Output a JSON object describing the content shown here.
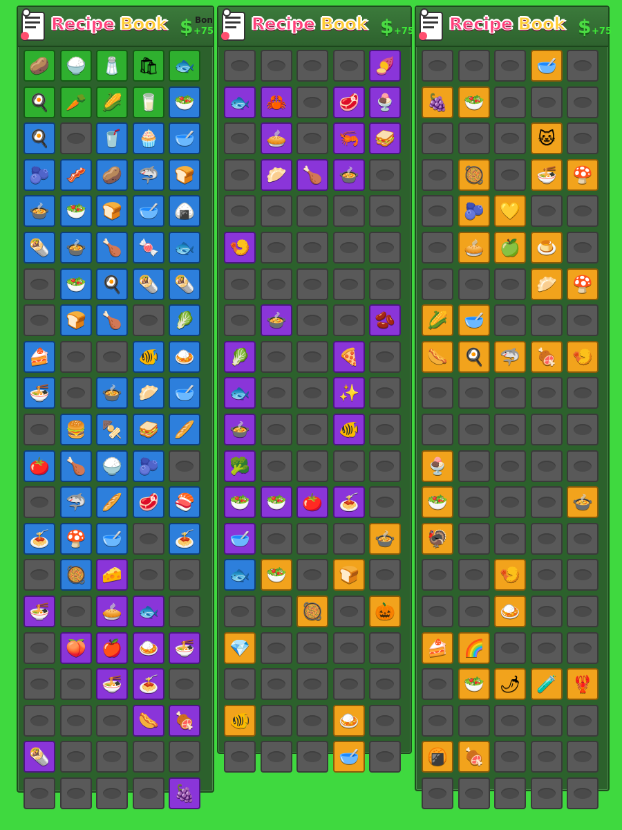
{
  "panels": [
    {
      "title_part1": "Recipe ",
      "title_part2": "Book",
      "bonus_label": "Bon",
      "bonus_value": "+75",
      "rows": [
        [
          "green:potato-icon:🥔",
          "green:rice-bowl-icon:🍚",
          "green:salt-shaker-icon:🧂",
          "green:toasted-flour-bag-icon:🛍",
          "green:fish-icon:🐟"
        ],
        [
          "green:fried-egg-icon:🍳",
          "green:carrots-icon:🥕",
          "green:corn-icon:🌽",
          "green:milk-glass-icon:🥛",
          "blue:salad-icon:🥗"
        ],
        [
          "blue:omelette-icon:🍳",
          "locked",
          "blue:smoothie-icon:🥤",
          "blue:muffin-icon:🧁",
          "blue:oatmeal-icon:🥣"
        ],
        [
          "blue:berry-bowl-icon:🫐",
          "blue:bacon-eggs-icon:🥓",
          "blue:baked-potato-icon:🥔",
          "blue:shark-fin-icon:🦈",
          "blue:bread-loaf-icon:🍞"
        ],
        [
          "blue:soup-icon:🍲",
          "blue:vegetable-salad-icon:🥗",
          "blue:toast-icon:🍞",
          "blue:cream-soup-icon:🥣",
          "blue:onigiri-icon:🍙"
        ],
        [
          "blue:burrito-icon:🌯",
          "blue:rice-soup-icon:🍲",
          "blue:drumstick-icon:🍗",
          "blue:candy-icon:🍬",
          "blue:grilled-fish-icon:🐟"
        ],
        [
          "locked",
          "blue:veggie-rice-icon:🥗",
          "blue:egg-toast-icon:🍳",
          "blue:wrap-icon:🌯",
          "blue:burrito-plate-icon:🌯"
        ],
        [
          "locked",
          "blue:bread-icon:🍞",
          "blue:chicken-legs-icon:🍗",
          "locked",
          "blue:herb-dish-icon:🥬"
        ],
        [
          "blue:cake-slice-icon:🍰",
          "locked",
          "locked",
          "blue:fish-salad-icon:🐠",
          "blue:fried-rice-icon:🍛"
        ],
        [
          "blue:ramen-icon:🍜",
          "locked",
          "blue:stew-icon:🍲",
          "blue:dumplings-icon:🥟",
          "blue:porridge-icon:🥣"
        ],
        [
          "locked",
          "blue:burger-icon:🍔",
          "blue:kebab-icon:🍢",
          "blue:sandwich-icon:🥪",
          "blue:bread-roll-icon:🥖"
        ],
        [
          "blue:tomato-icon:🍅",
          "blue:roast-chicken-icon:🍗",
          "blue:steamed-rice-icon:🍚",
          "blue:blueberry-bowl-icon:🫐",
          "locked"
        ],
        [
          "locked",
          "blue:shark-fin-soup-icon:🦈",
          "blue:breadsticks-icon:🥖",
          "blue:steak-icon:🥩",
          "blue:salmon-fillet-icon:🍣"
        ],
        [
          "blue:spaghetti-icon:🍝",
          "blue:shroom-flour-mix-icon:🍄",
          "blue:mushroom-soup-icon:🥣",
          "locked",
          "blue:pasta-bowl-icon:🍝"
        ],
        [
          "locked",
          "blue:stir-fry-icon:🥘",
          "purple:fruit-cheese-icon:🧀",
          "locked",
          "locked"
        ],
        [
          "purple:blue-noodles-icon:🍜",
          "locked",
          "purple:pie-icon:🥧",
          "purple:taiyaki-icon:🐟",
          "locked"
        ],
        [
          "locked",
          "purple:peach-icon:🍑",
          "purple:candy-apple-icon:🍎",
          "purple:curry-bowl-icon:🍛",
          "purple:noodle-bowl-icon:🍜"
        ],
        [
          "locked",
          "locked",
          "purple:noodle-soup-icon:🍜",
          "purple:pasta-plate-icon:🍝",
          "locked"
        ],
        [
          "locked",
          "locked",
          "locked",
          "purple:sausage-platter-icon:🌭",
          "purple:bbq-platter-icon:🍖"
        ],
        [
          "purple:wrap-roll-icon:🌯",
          "locked",
          "locked",
          "locked",
          "locked"
        ],
        [
          "locked",
          "locked",
          "locked",
          "locked",
          "purple:purple-dish-icon:🍇"
        ]
      ]
    },
    {
      "title_part1": "Recipe ",
      "title_part2": "Book",
      "bonus_label": "",
      "bonus_value": "+75",
      "rows": [
        [
          "locked",
          "locked",
          "locked",
          "locked",
          "purple:ube-bowl-icon:🍠"
        ],
        [
          "purple:fish-plate-icon:🐟",
          "purple:crab-bowl-icon:🦀",
          "locked",
          "purple:steak-plate-icon:🥩",
          "purple:parfait-icon:🍨"
        ],
        [
          "locked",
          "purple:berry-tart-icon:🥧",
          "locked",
          "purple:seafood-bowl-icon:🦐",
          "purple:bruschetta-icon:🥪"
        ],
        [
          "locked",
          "purple:blue-dumplings-icon:🥟",
          "purple:roast-fowl-icon:🍗",
          "purple:pot-stew-icon:🍲",
          "locked"
        ],
        [
          "locked",
          "locked",
          "locked",
          "locked",
          "locked"
        ],
        [
          "purple:fried-snacks-icon:🍤",
          "locked",
          "locked",
          "locked",
          "locked"
        ],
        [
          "locked",
          "locked",
          "locked",
          "locked",
          "locked"
        ],
        [
          "locked",
          "purple:hotpot-icon:🍲",
          "locked",
          "locked",
          "purple:bean-bowl-icon:🫘"
        ],
        [
          "purple:asparagus-icon:🥬",
          "locked",
          "locked",
          "purple:pizza-plate-icon:🍕",
          "locked"
        ],
        [
          "purple:fish-stew-icon:🐟",
          "locked",
          "locked",
          "purple:magic-soup-icon:✨",
          "locked"
        ],
        [
          "purple:lentil-pot-icon:🍲",
          "locked",
          "locked",
          "purple:grilled-fish-plate-icon:🐠",
          "locked"
        ],
        [
          "purple:broccoli-bowl-icon:🥦",
          "locked",
          "locked",
          "locked",
          "locked"
        ],
        [
          "purple:mixed-salad-icon:🥗",
          "purple:veggie-bowl-icon:🥗",
          "purple:tomato-soup-icon:🍅",
          "purple:noodle-dish-icon:🍝",
          "locked"
        ],
        [
          "purple:yogurt-bowl-icon:🥣",
          "locked",
          "locked",
          "locked",
          "orange:beef-stew-icon:🍲"
        ],
        [
          "blue:salmon-steak-icon:🐟",
          "orange:salad-bowl-icon:🥗",
          "locked",
          "orange:caviar-toast-icon:🍞",
          "locked"
        ],
        [
          "locked",
          "locked",
          "orange:chowder-icon:🥘",
          "locked",
          "orange:pumpkin-soup-icon:🎃"
        ],
        [
          "orange:crystal-bowl-icon:💎",
          "locked",
          "locked",
          "locked",
          "locked"
        ],
        [
          "locked",
          "locked",
          "locked",
          "locked",
          "locked"
        ],
        [
          "orange:fish-feast-icon:🐠",
          "locked",
          "locked",
          "orange:curry-stew-icon:🍛",
          "locked"
        ],
        [
          "locked",
          "locked",
          "locked",
          "orange:soup-bowl-icon:🥣",
          "locked"
        ]
      ]
    },
    {
      "title_part1": "Recipe ",
      "title_part2": "Book",
      "bonus_label": "",
      "bonus_value": "+75",
      "rows": [
        [
          "locked",
          "locked",
          "locked",
          "orange:dumpling-soup-icon:🥣",
          "locked"
        ],
        [
          "orange:fruit-bowl-icon:🍇",
          "orange:garden-salad-icon:🥗",
          "locked",
          "locked",
          "locked"
        ],
        [
          "locked",
          "locked",
          "locked",
          "orange:cat-parfait-icon:🐱",
          "locked"
        ],
        [
          "locked",
          "orange:veggie-stew-icon:🥘",
          "locked",
          "orange:noodle-platter-icon:🍜",
          "orange:mushroom-stew-icon:🍄"
        ],
        [
          "locked",
          "orange:berry-bowl-icon:🫐",
          "orange:heart-dessert-icon:💛",
          "locked",
          "locked"
        ],
        [
          "locked",
          "orange:fruit-tart-icon:🥧",
          "orange:golden-apple-icon:🍏",
          "orange:pudding-icon:🍮",
          "locked"
        ],
        [
          "locked",
          "locked",
          "locked",
          "orange:dim-sum-icon:🥟",
          "orange:mushroom-pie-icon:🍄"
        ],
        [
          "orange:harvest-platter-icon:🌽",
          "orange:corn-soup-icon:🥣",
          "locked",
          "locked",
          "locked"
        ],
        [
          "orange:sausage-grill-icon:🌭",
          "orange:omelette-plate-icon:🍳",
          "orange:shark-soup-icon:🦈",
          "orange:roast-plate-icon:🍖",
          "orange:seafood-pasta-icon:🍤"
        ],
        [
          "locked",
          "locked",
          "locked",
          "locked",
          "locked"
        ],
        [
          "locked",
          "locked",
          "locked",
          "locked",
          "locked"
        ],
        [
          "orange:ice-cream-sundae-icon:🍨",
          "locked",
          "locked",
          "locked",
          "locked"
        ],
        [
          "orange:herb-salad-icon:🥗",
          "locked",
          "locked",
          "locked",
          "orange:goulash-icon:🍲"
        ],
        [
          "orange:roast-turkey-icon:🦃",
          "locked",
          "locked",
          "locked",
          "locked"
        ],
        [
          "locked",
          "locked",
          "orange:shrimp-plate-icon:🍤",
          "locked",
          "locked"
        ],
        [
          "locked",
          "locked",
          "orange:rice-plate-icon:🍛",
          "locked",
          "locked"
        ],
        [
          "orange:fancy-cake-icon:🍰",
          "orange:rainbow-cake-icon:🌈",
          "locked",
          "locked",
          "locked"
        ],
        [
          "locked",
          "orange:green-salad-icon:🥗",
          "orange:chili-dish-icon:🌶",
          "orange:rainbow-potion-icon:🧪",
          "orange:lobster-feast-icon:🦞"
        ],
        [
          "locked",
          "locked",
          "locked",
          "locked",
          "locked"
        ],
        [
          "orange:fried-croquettes-icon:🍘",
          "orange:roast-ham-icon:🍖",
          "locked",
          "locked",
          "locked"
        ],
        [
          "locked",
          "locked",
          "locked",
          "locked",
          "locked"
        ]
      ]
    }
  ],
  "colors": {
    "background": "#3fd93f",
    "panel": "#2c612c",
    "locked": "#595959",
    "tier_green": "#2fb02f",
    "tier_blue": "#2d7fdc",
    "tier_purple": "#8a35d9",
    "tier_orange": "#f2a31c"
  }
}
